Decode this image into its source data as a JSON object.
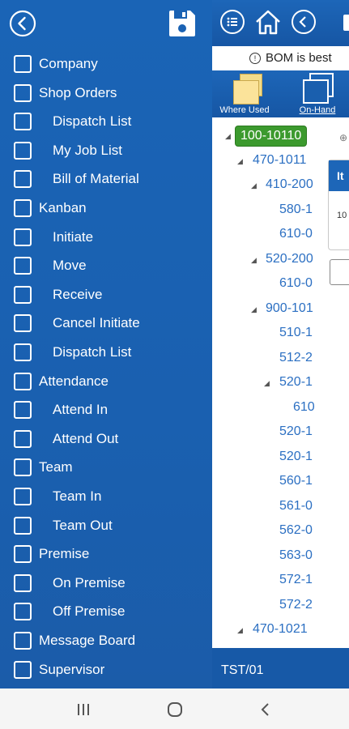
{
  "background_screen": {
    "notice_text": "BOM is best",
    "tools": [
      {
        "label": "Where Used"
      },
      {
        "label": "On-Hand"
      }
    ],
    "tree_nodes": [
      {
        "text": "100-10110",
        "selected": true
      },
      {
        "text": "470-1011"
      },
      {
        "text": "410-200"
      },
      {
        "text": "580-1"
      },
      {
        "text": "610-0"
      },
      {
        "text": "520-200"
      },
      {
        "text": "610-0"
      },
      {
        "text": "900-101"
      },
      {
        "text": "510-1"
      },
      {
        "text": "512-2"
      },
      {
        "text": "520-1"
      },
      {
        "text": "610"
      },
      {
        "text": "520-1"
      },
      {
        "text": "520-1"
      },
      {
        "text": "560-1"
      },
      {
        "text": "561-0"
      },
      {
        "text": "562-0"
      },
      {
        "text": "563-0"
      },
      {
        "text": "572-1"
      },
      {
        "text": "572-2"
      },
      {
        "text": "470-1021"
      }
    ],
    "panel_header": "It",
    "panel_value": "10",
    "footer_text": "TST/01"
  },
  "drawer": {
    "back_icon": "chevron-left-circle-icon",
    "save_icon": "floppy-disk-icon",
    "items": [
      {
        "label": "Company",
        "indent": false
      },
      {
        "label": "Shop Orders",
        "indent": false
      },
      {
        "label": "Dispatch List",
        "indent": true
      },
      {
        "label": "My Job List",
        "indent": true
      },
      {
        "label": "Bill of Material",
        "indent": true
      },
      {
        "label": "Kanban",
        "indent": false
      },
      {
        "label": "Initiate",
        "indent": true
      },
      {
        "label": "Move",
        "indent": true
      },
      {
        "label": "Receive",
        "indent": true
      },
      {
        "label": "Cancel Initiate",
        "indent": true
      },
      {
        "label": "Dispatch List",
        "indent": true
      },
      {
        "label": "Attendance",
        "indent": false
      },
      {
        "label": "Attend In",
        "indent": true
      },
      {
        "label": "Attend Out",
        "indent": true
      },
      {
        "label": "Team",
        "indent": false
      },
      {
        "label": "Team In",
        "indent": true
      },
      {
        "label": "Team Out",
        "indent": true
      },
      {
        "label": "Premise",
        "indent": false
      },
      {
        "label": "On Premise",
        "indent": true
      },
      {
        "label": "Off Premise",
        "indent": true
      },
      {
        "label": "Message Board",
        "indent": false
      },
      {
        "label": "Supervisor",
        "indent": false
      }
    ]
  },
  "system_nav": {
    "recents_icon": "recents-icon",
    "home_icon": "home-circle-icon",
    "back_icon": "back-chevron-icon"
  },
  "colors": {
    "drawer_blue": "#1a62b3",
    "selected_node_green": "#3c9a2e",
    "tree_text_blue": "#2b6fc2"
  }
}
